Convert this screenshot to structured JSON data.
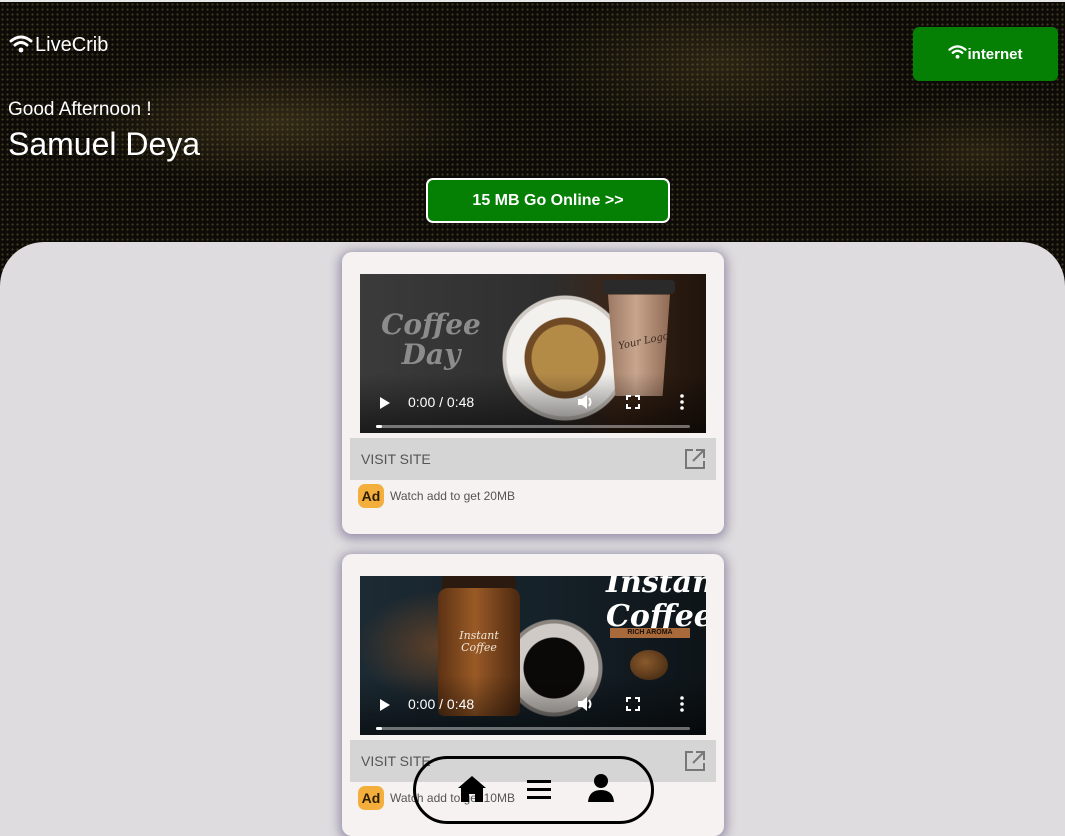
{
  "header": {
    "brand": "LiveCrib",
    "brand_icon": "wifi-icon",
    "greeting": "Good Afternoon !",
    "user_name": "Samuel Deya",
    "internet_button": "internet",
    "go_online_button": "15 MB Go Online >>",
    "accent_color": "#058005"
  },
  "ads": [
    {
      "thumbnail_text": "Coffee Day",
      "thumbnail_logo_text": "Your Logo",
      "video_time": "0:00 / 0:48",
      "progress": 0.02,
      "visit_label": "VISIT SITE",
      "badge": "Ad",
      "note": "Watch add to get 20MB"
    },
    {
      "thumbnail_text": "Instant Coffee",
      "thumbnail_sub_text": "RICH AROMA",
      "thumbnail_label_text": "Instant Coffee",
      "video_time": "0:00 / 0:48",
      "progress": 0.02,
      "visit_label": "VISIT SITE",
      "badge": "Ad",
      "note": "Watch add to get 10MB"
    }
  ],
  "bottom_nav": {
    "items": [
      "home-icon",
      "menu-icon",
      "profile-icon"
    ]
  }
}
